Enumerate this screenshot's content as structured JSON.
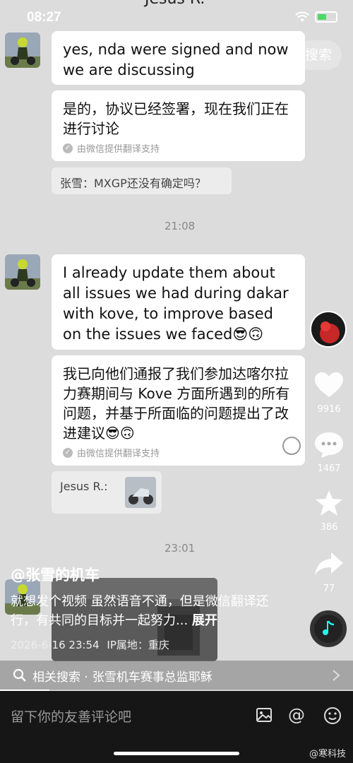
{
  "status_bar": {
    "time": "08:27"
  },
  "header": {
    "title": "Jesus R.",
    "search_label": "搜索"
  },
  "messages": [
    {
      "text": "yes, nda were signed and now we are discussing"
    },
    {
      "text": "是的，协议已经签署，现在我们正在进行讨论",
      "translation_note": "由微信提供翻译支持"
    },
    {
      "quote": "张雪：MXGP还没有确定吗？"
    },
    {
      "timestamp": "21:08"
    },
    {
      "text": "I already update them about all issues we had during dakar with kove, to improve based on the issues we faced😎🙃"
    },
    {
      "text": "我已向他们通报了我们参加达喀尔拉力赛期间与 Kove 方面所遇到的所有问题，并基于所面临的问题提出了改进建议😎🙃",
      "translation_note": "由微信提供翻译支持"
    },
    {
      "quote": "Jesus R.:"
    },
    {
      "timestamp": "23:01"
    }
  ],
  "sidebar": {
    "likes": "9916",
    "comments": "1467",
    "favorites": "386",
    "shares": "77"
  },
  "post": {
    "author": "@张雪的机车",
    "description": "就想发个视频 虽然语音不通，但是微信翻译还行，有共同的目标并一起努力...",
    "expand_label": "展开",
    "date": "2026-6-16 23:54",
    "location": "IP属地：重庆"
  },
  "related_search": {
    "prefix": "相关搜索 ·",
    "query": "张雪机车赛事总监耶稣"
  },
  "video_progress": 0.14,
  "comment_bar": {
    "placeholder": "留下你的友善评论吧"
  },
  "watermark": "@寒科技",
  "colors": {
    "like_accent": "#fe2c55",
    "battery": "#4cd964"
  }
}
